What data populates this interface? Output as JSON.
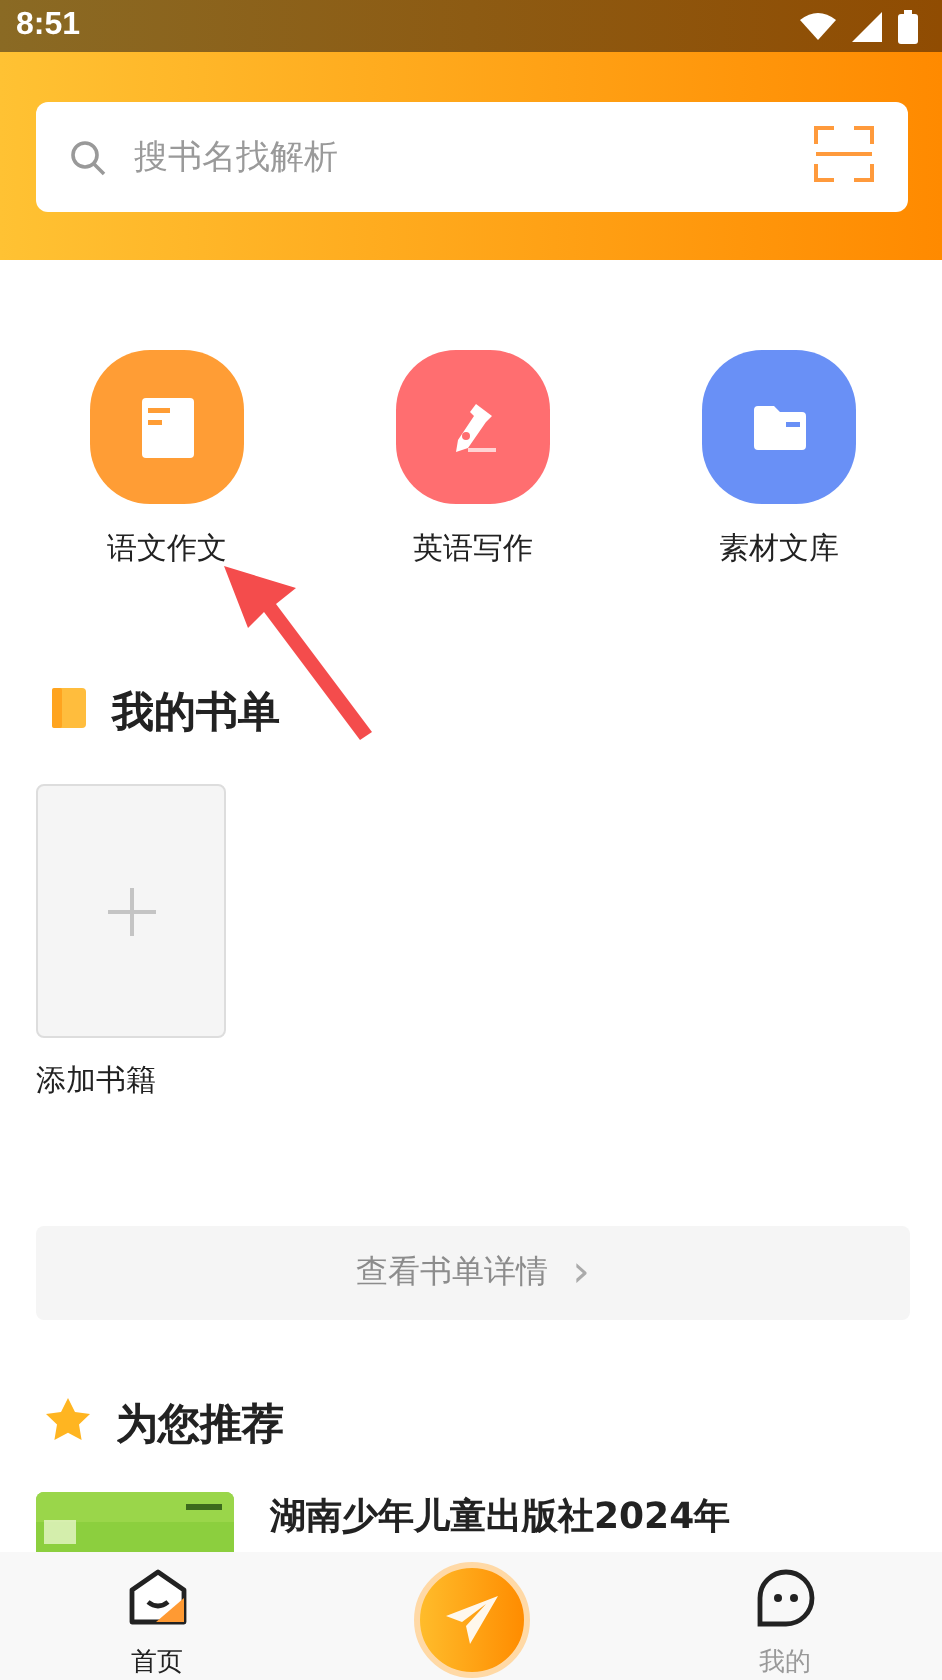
{
  "status_bar": {
    "time": "8:51"
  },
  "search": {
    "placeholder": "搜书名找解析"
  },
  "shortcuts": [
    {
      "label": "语文作文",
      "color": "#ff9d35",
      "kind": "notebook"
    },
    {
      "label": "英语写作",
      "color": "#ff6e70",
      "kind": "pen"
    },
    {
      "label": "素材文库",
      "color": "#6990f6",
      "kind": "folder"
    }
  ],
  "book_list": {
    "title": "我的书单",
    "add_label": "添加书籍",
    "details_button": "查看书单详情",
    "details_arrow": "›"
  },
  "recommend": {
    "title": "为您推荐",
    "books": [
      {
        "title": "湖南少年儿童出版社2024年"
      }
    ]
  },
  "nav": {
    "tabs": [
      {
        "label": "首页",
        "selected": true,
        "kind": "home"
      },
      {
        "label": "我的",
        "selected": false,
        "kind": "chat"
      }
    ]
  }
}
